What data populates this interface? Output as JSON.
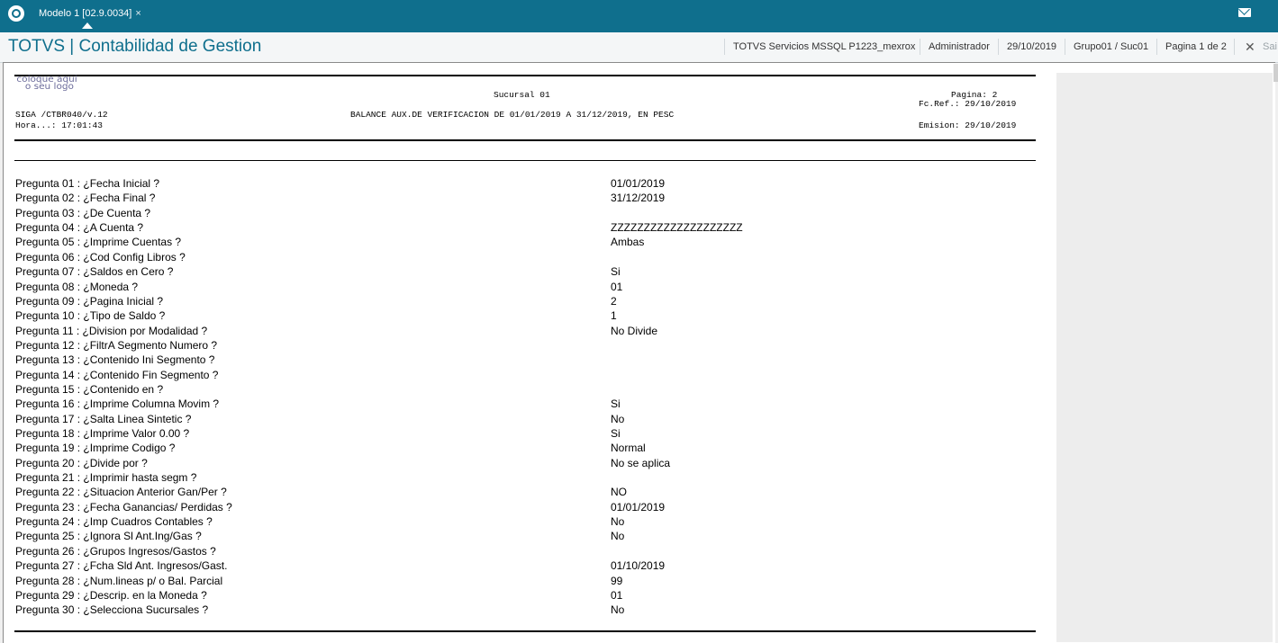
{
  "topbar": {
    "tab_label": "Modelo 1 [02.9.0034]",
    "tab_close": "×"
  },
  "header": {
    "title": "TOTVS | Contabilidad de Gestion",
    "environment": "TOTVS Servicios MSSQL P1223_mexrox",
    "user": "Administrador",
    "date": "29/10/2019",
    "branch": "Grupo01 / Suc01",
    "page_info": "Pagina 1 de 2",
    "exit_label": "Sai"
  },
  "report": {
    "logo_line1": "coloque aqui",
    "logo_line2": "o seu logo",
    "branch_title": "Sucursal 01",
    "page_label": "Pagina:      2",
    "ref_date": "Fc.Ref.: 29/10/2019",
    "program": "SIGA /CTBR040/v.12",
    "report_title": "BALANCE AUX.DE VERIFICACION DE 01/01/2019 A 31/12/2019, EN PESC",
    "time": "Hora...: 17:01:43",
    "emission": "Emision: 29/10/2019"
  },
  "questions": [
    {
      "label": "Pregunta 01 : ¿Fecha Inicial ?",
      "value": "01/01/2019"
    },
    {
      "label": "Pregunta 02 : ¿Fecha Final ?",
      "value": "31/12/2019"
    },
    {
      "label": "Pregunta 03 : ¿De Cuenta ?",
      "value": ""
    },
    {
      "label": "Pregunta 04 : ¿A Cuenta ?",
      "value": "ZZZZZZZZZZZZZZZZZZZZ"
    },
    {
      "label": "Pregunta 05 : ¿Imprime Cuentas ?",
      "value": "Ambas"
    },
    {
      "label": "Pregunta 06 : ¿Cod Config Libros ?",
      "value": ""
    },
    {
      "label": "Pregunta 07 : ¿Saldos en Cero ?",
      "value": "Si"
    },
    {
      "label": "Pregunta 08 : ¿Moneda ?",
      "value": "01"
    },
    {
      "label": "Pregunta 09 : ¿Pagina Inicial ?",
      "value": "2"
    },
    {
      "label": "Pregunta 10 : ¿Tipo de Saldo ?",
      "value": "1"
    },
    {
      "label": "Pregunta 11 : ¿Division por Modalidad ?",
      "value": "No Divide"
    },
    {
      "label": "Pregunta 12 : ¿FiltrA Segmento Numero ?",
      "value": ""
    },
    {
      "label": "Pregunta 13 : ¿Contenido Ini Segmento ?",
      "value": ""
    },
    {
      "label": "Pregunta 14 : ¿Contenido Fin Segmento ?",
      "value": ""
    },
    {
      "label": "Pregunta 15 : ¿Contenido en ?",
      "value": ""
    },
    {
      "label": "Pregunta 16 : ¿Imprime Columna Movim ?",
      "value": "Si"
    },
    {
      "label": "Pregunta 17 : ¿Salta Linea Sintetic ?",
      "value": "No"
    },
    {
      "label": "Pregunta 18 : ¿Imprime Valor 0.00 ?",
      "value": "Si"
    },
    {
      "label": "Pregunta 19 : ¿Imprime Codigo ?",
      "value": "Normal"
    },
    {
      "label": "Pregunta 20 : ¿Divide por ?",
      "value": "No se aplica"
    },
    {
      "label": "Pregunta 21 : ¿Imprimir hasta segm ?",
      "value": ""
    },
    {
      "label": "Pregunta 22 : ¿Situacion Anterior Gan/Per ?",
      "value": "NO"
    },
    {
      "label": "Pregunta 23 : ¿Fecha Ganancias/ Perdidas ?",
      "value": "01/01/2019"
    },
    {
      "label": "Pregunta 24 : ¿Imp Cuadros Contables ?",
      "value": "No"
    },
    {
      "label": "Pregunta 25 : ¿Ignora Sl Ant.Ing/Gas ?",
      "value": "No"
    },
    {
      "label": "Pregunta 26 : ¿Grupos Ingresos/Gastos ?",
      "value": ""
    },
    {
      "label": "Pregunta 27 : ¿Fcha Sld Ant. Ingresos/Gast.",
      "value": "01/10/2019"
    },
    {
      "label": "Pregunta 28 : ¿Num.lineas p/ o Bal. Parcial",
      "value": "99"
    },
    {
      "label": "Pregunta 29 : ¿Descrip. en la Moneda ?",
      "value": "01"
    },
    {
      "label": "Pregunta 30 : ¿Selecciona Sucursales ?",
      "value": "No"
    }
  ]
}
